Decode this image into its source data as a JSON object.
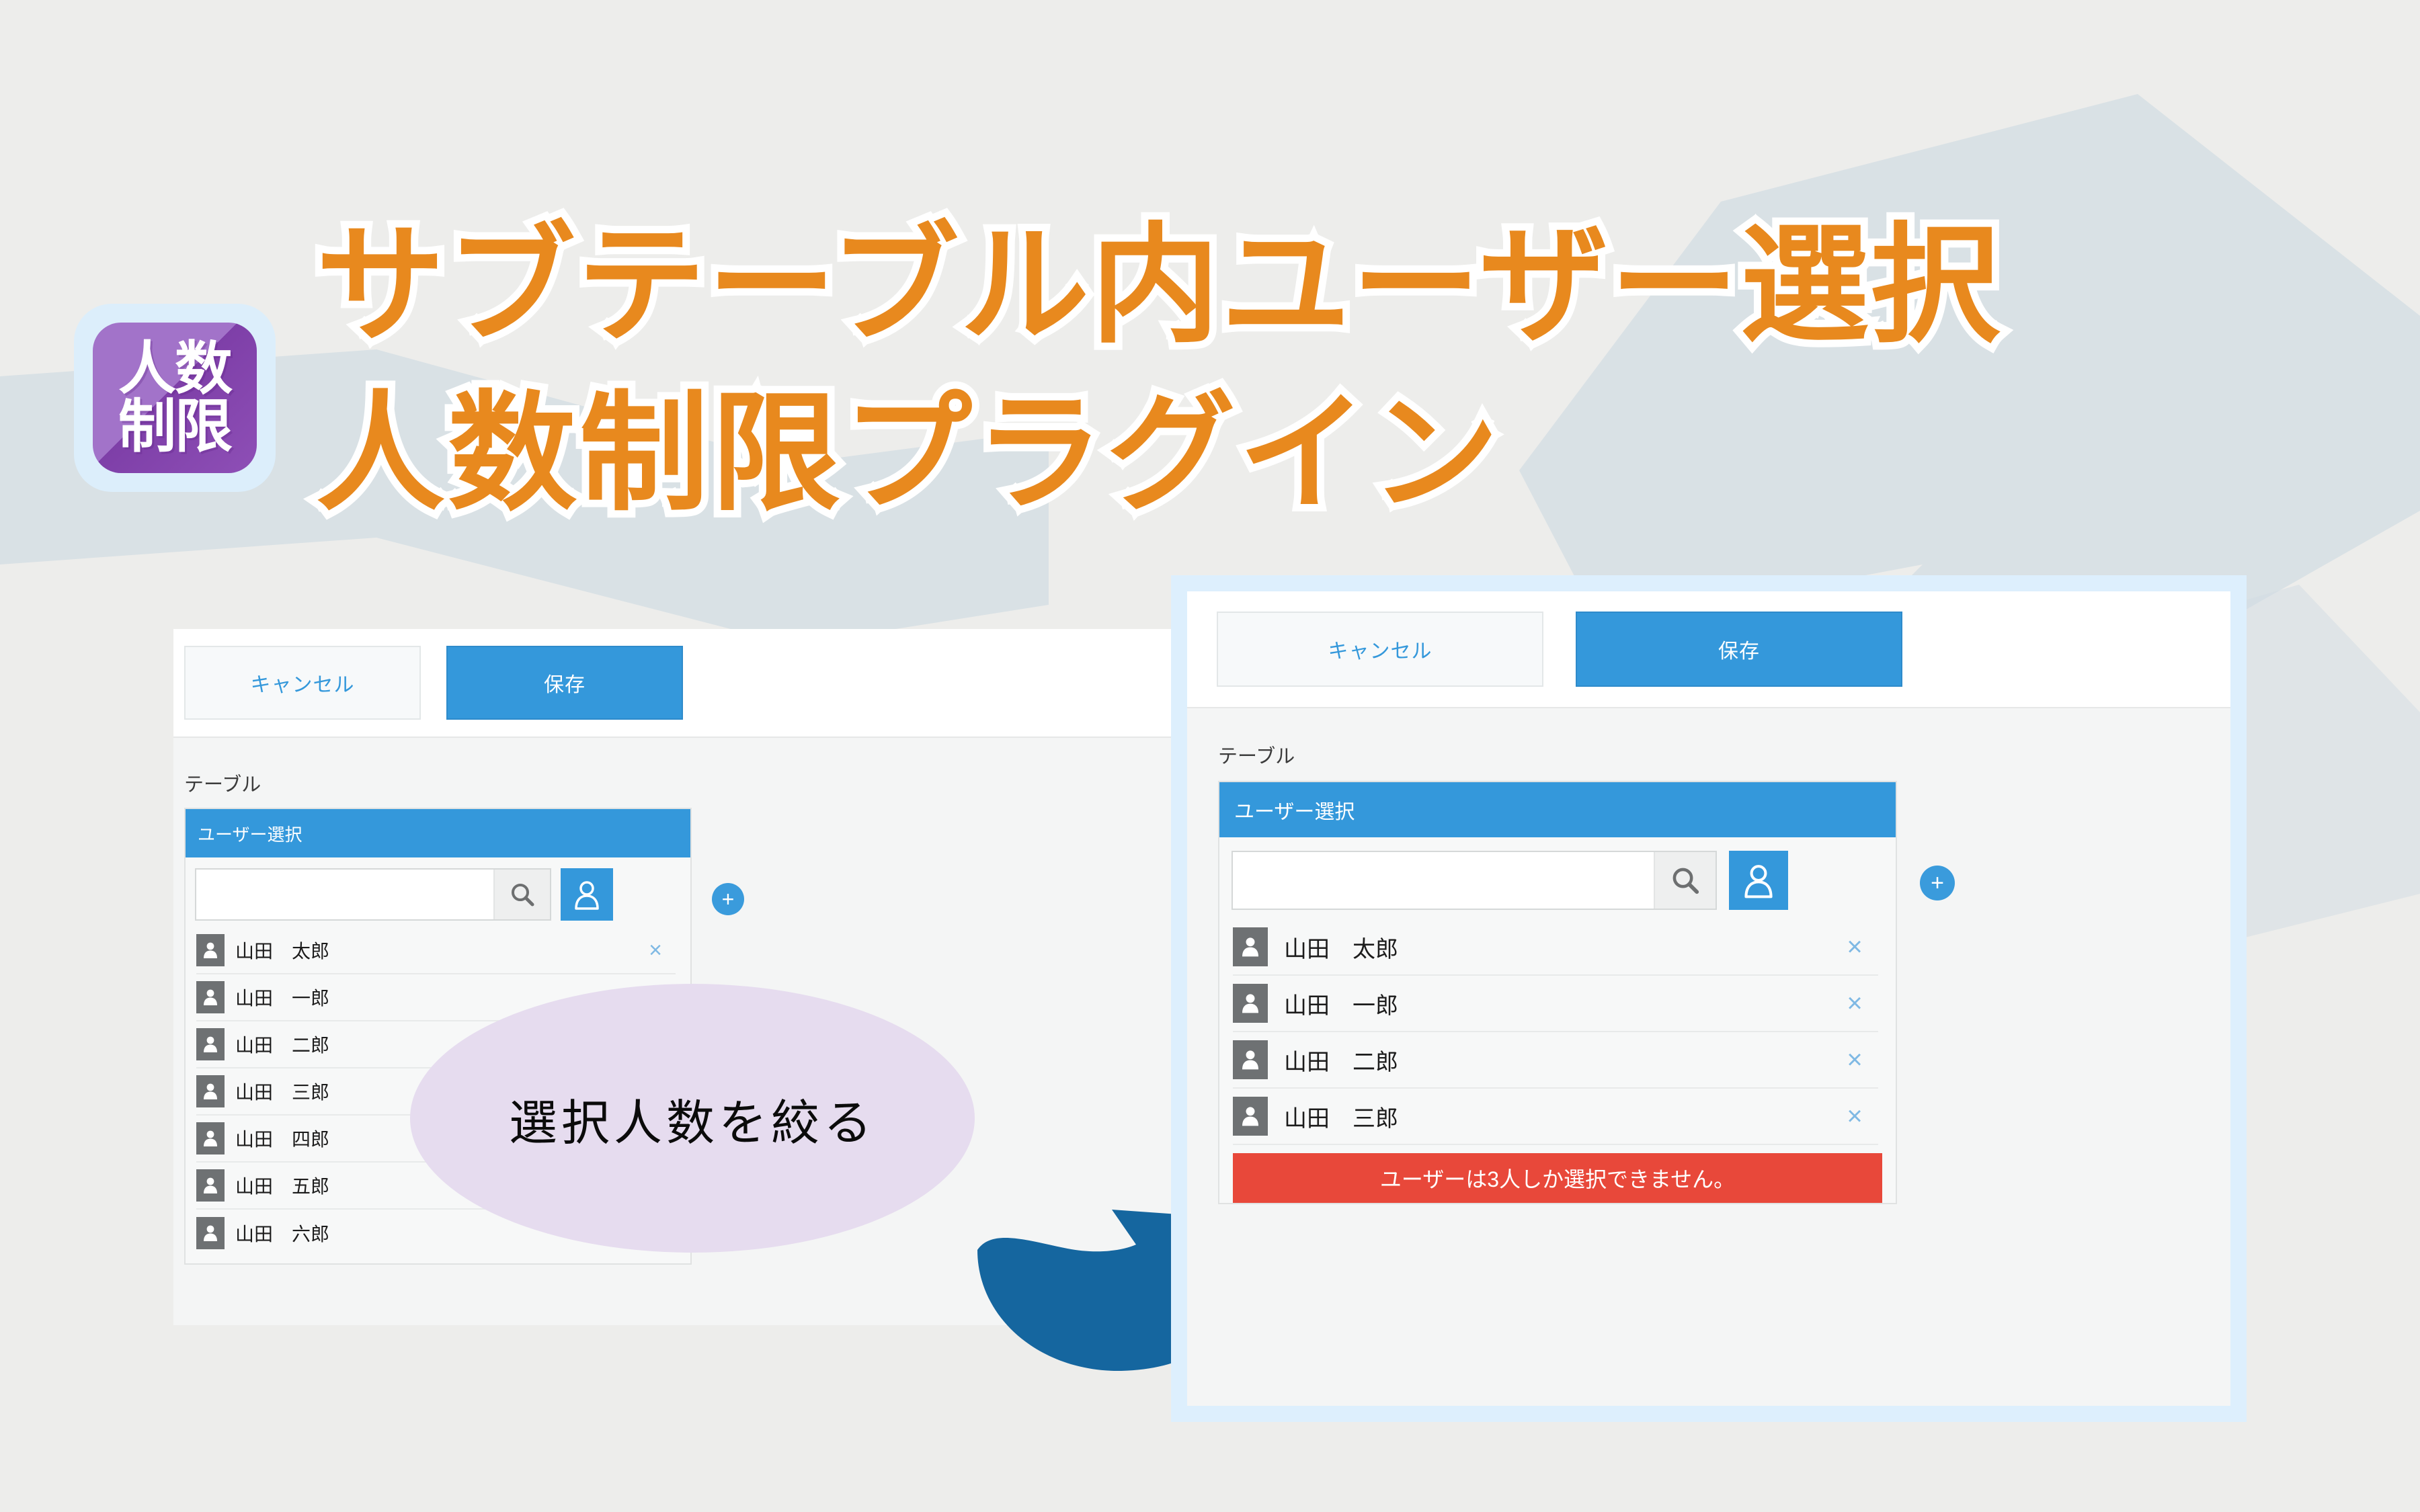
{
  "hero": {
    "badge": {
      "line1": "人数",
      "line2": "制限",
      "bg_color": "#A273C9",
      "outer_color": "#DCEEFB"
    },
    "title_line1": "サブテーブル内ユーザー選択",
    "title_line2": "人数制限プラグイン",
    "title_color": "#E8891E",
    "title_outline_color": "#FFFFFF"
  },
  "callout": {
    "text": "選択人数を絞る",
    "bubble_color": "#E6DCEF"
  },
  "arrow": {
    "color": "#15669F",
    "direction": "up-right"
  },
  "colors": {
    "accent_blue": "#3498DB",
    "error_red": "#E8483A",
    "page_bg": "#EDEDEB",
    "frame_blue": "#DDEFFD",
    "decor_blue_gray": "#CFDAE2"
  },
  "panel_before": {
    "toolbar": {
      "cancel_label": "キャンセル",
      "save_label": "保存"
    },
    "field_label": "テーブル",
    "column_header": "ユーザー選択",
    "search": {
      "value": "",
      "placeholder": ""
    },
    "add_row_label": "+",
    "users": [
      "山田　太郎",
      "山田　一郎",
      "山田　二郎",
      "山田　三郎",
      "山田　四郎",
      "山田　五郎",
      "山田　六郎"
    ],
    "remove_label": "×"
  },
  "panel_after": {
    "toolbar": {
      "cancel_label": "キャンセル",
      "save_label": "保存"
    },
    "field_label": "テーブル",
    "column_header": "ユーザー選択",
    "search": {
      "value": "",
      "placeholder": ""
    },
    "add_row_label": "+",
    "users": [
      "山田　太郎",
      "山田　一郎",
      "山田　二郎",
      "山田　三郎"
    ],
    "remove_label": "×",
    "error_message": "ユーザーは3人しか選択できません。"
  }
}
